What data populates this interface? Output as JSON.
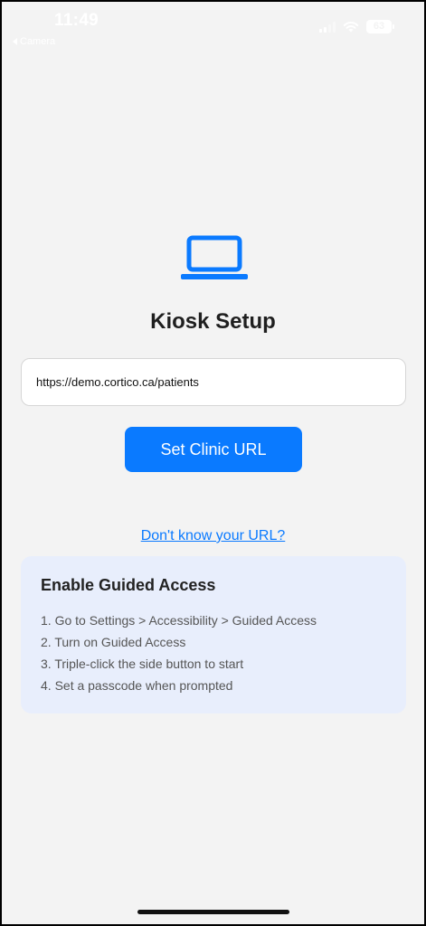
{
  "status_bar": {
    "time": "11:49",
    "back_app": "Camera",
    "battery": "63"
  },
  "main": {
    "icon": "laptop-icon",
    "title": "Kiosk Setup",
    "url_input_value": "https://demo.cortico.ca/patients",
    "set_url_button": "Set Clinic URL",
    "help_link": "Don't know your URL?"
  },
  "guided_access": {
    "title": "Enable Guided Access",
    "steps": [
      "1. Go to Settings > Accessibility > Guided Access",
      "2. Turn on Guided Access",
      "3. Triple-click the side button to start",
      "4. Set a passcode when prompted"
    ]
  },
  "colors": {
    "accent": "#0a7aff",
    "background": "#f3f3f3",
    "panel": "#e8eefc"
  }
}
